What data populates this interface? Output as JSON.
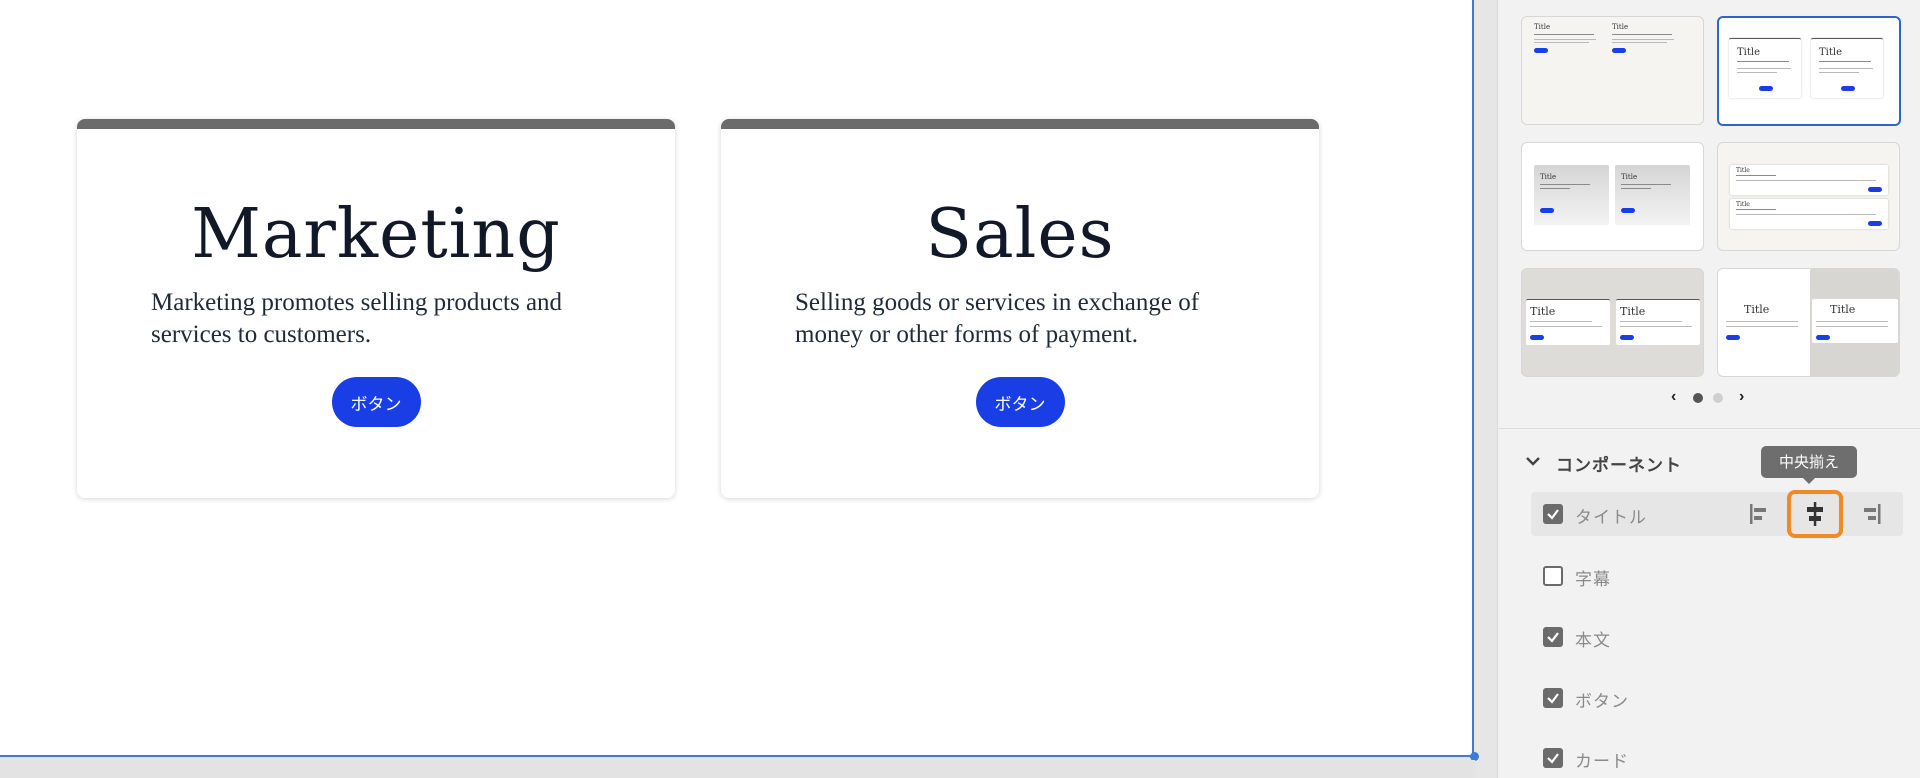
{
  "cards": [
    {
      "title": "Marketing",
      "body": "Marketing promotes selling products and services to customers.",
      "button": "ボタン"
    },
    {
      "title": "Sales",
      "body": "Selling goods or services in exchange of money or other forms of payment.",
      "button": "ボタン"
    }
  ],
  "panel": {
    "layouts_label": "Title",
    "pager": {
      "current_page": 1,
      "total_pages": 2
    },
    "section_title": "コンポーネント",
    "tooltip": "中央揃え",
    "components": [
      {
        "label": "タイトル",
        "checked": true
      },
      {
        "label": "字幕",
        "checked": false
      },
      {
        "label": "本文",
        "checked": true
      },
      {
        "label": "ボタン",
        "checked": true
      },
      {
        "label": "カード",
        "checked": true
      }
    ]
  },
  "colors": {
    "accent": "#1a3ee6",
    "selection": "#2d66c8",
    "highlight_outline": "#f08a24",
    "card_topbar": "#6b6b6b"
  }
}
